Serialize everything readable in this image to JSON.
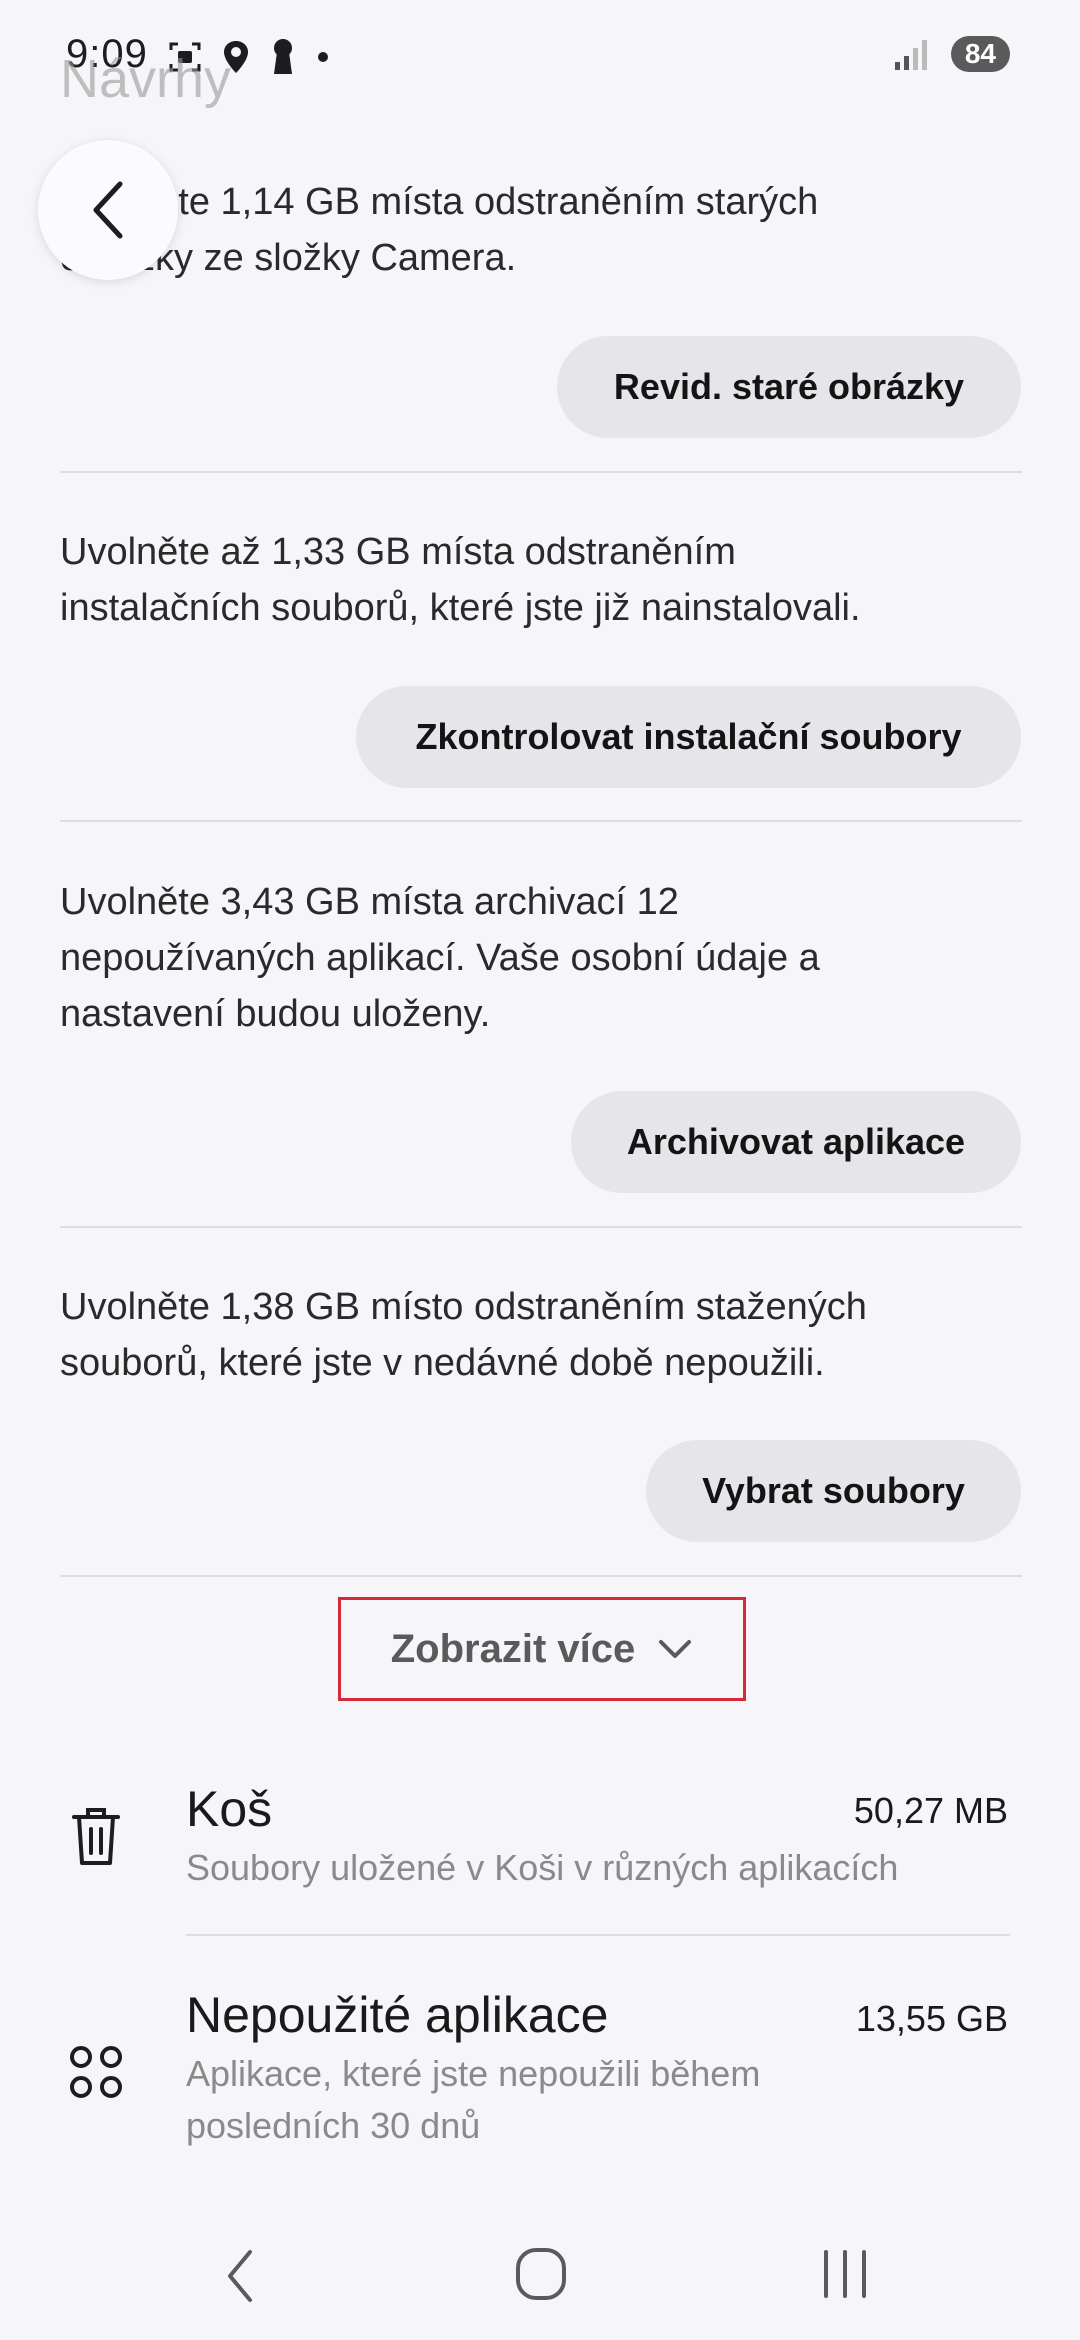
{
  "status_bar": {
    "time": "9:09",
    "battery": "84"
  },
  "header": {
    "title": "Návrhy"
  },
  "suggestions": [
    {
      "text_line1": "Uvolněte 1,14 GB místa odstraněním starých",
      "text_line2": "obrázky ze složky Camera.",
      "button": "Revid. staré obrázky"
    },
    {
      "text_line1": "Uvolněte až 1,33 GB místa odstraněním",
      "text_line2": "instalačních souborů, které jste již nainstalovali.",
      "button": "Zkontrolovat instalační soubory"
    },
    {
      "text_line1": "Uvolněte 3,43 GB místa archivací 12",
      "text_line2": "nepoužívaných aplikací. Vaše osobní údaje a",
      "text_line3": "nastavení budou uloženy.",
      "button": "Archivovat aplikace"
    },
    {
      "text_line1": "Uvolněte 1,38 GB místo odstraněním stažených",
      "text_line2": "souborů, které jste v nedávné době nepoužili.",
      "button": "Vybrat soubory"
    }
  ],
  "show_more": "Zobrazit více",
  "storage_items": [
    {
      "icon": "trash-icon",
      "title": "Koš",
      "subtitle": "Soubory uložené v Koši v různých aplikacích",
      "size": "50,27 MB"
    },
    {
      "icon": "apps-icon",
      "title": "Nepoužité aplikace",
      "subtitle_line1": "Aplikace, které jste nepoužili během",
      "subtitle_line2": "posledních 30 dnů",
      "size": "13,55 GB"
    }
  ],
  "colors": {
    "background": "#f6f5f9",
    "pill": "#e6e6ea",
    "highlight_border": "#d62a36"
  }
}
